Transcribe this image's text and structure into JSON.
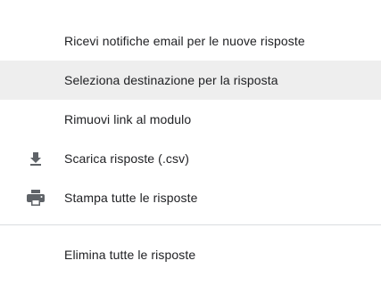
{
  "menu": {
    "items": [
      {
        "label": "Ricevi notifiche email per le nuove risposte",
        "icon": ""
      },
      {
        "label": "Seleziona destinazione per la risposta",
        "icon": ""
      },
      {
        "label": "Rimuovi link al modulo",
        "icon": ""
      },
      {
        "label": "Scarica risposte (.csv)",
        "icon": "download-icon"
      },
      {
        "label": "Stampa tutte le risposte",
        "icon": "print-icon"
      }
    ],
    "danger_items": [
      {
        "label": "Elimina tutte le risposte",
        "icon": ""
      }
    ],
    "highlighted_item": "Seleziona destinazione per la risposta",
    "colors": {
      "text": "#202124",
      "icon": "#5f6368",
      "highlight_bg": "#eeeeee",
      "divider": "#dadce0"
    }
  }
}
